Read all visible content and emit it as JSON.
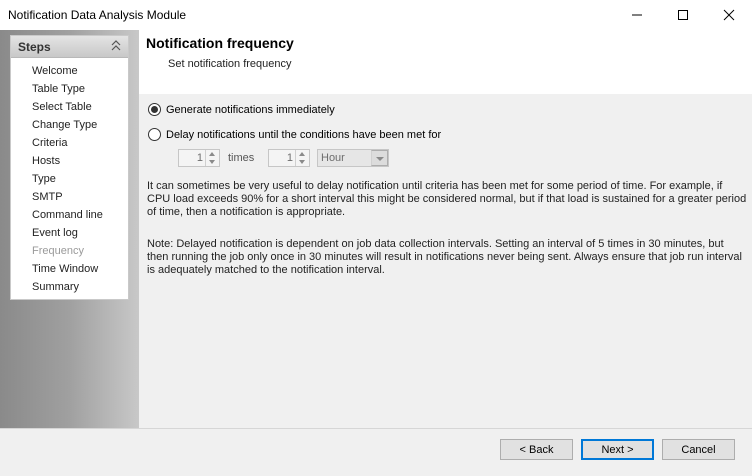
{
  "window": {
    "title": "Notification Data Analysis Module"
  },
  "steps": {
    "header": "Steps",
    "items": [
      "Welcome",
      "Table Type",
      "Select Table",
      "Change Type",
      "Criteria",
      "Hosts",
      "Type",
      "SMTP",
      "Command line",
      "Event log",
      "Frequency",
      "Time Window",
      "Summary"
    ],
    "current": "Frequency"
  },
  "page": {
    "title": "Notification frequency",
    "subtitle": "Set notification frequency"
  },
  "options": {
    "immediate_label": "Generate notifications immediately",
    "immediate_selected": true,
    "delay_label": "Delay notifications until the conditions have been met for",
    "delay_selected": false,
    "times_value": "1",
    "times_label": "times",
    "interval_value": "1",
    "unit_value": "Hour"
  },
  "text": {
    "para1": "It can sometimes be very useful to delay notification until criteria has been met for some period of time.  For example, if CPU load exceeds 90% for a short interval this might be considered normal, but if that load is sustained for a greater period of time, then a notification is appropriate.",
    "para2": "Note: Delayed notification is dependent on job data collection intervals.  Setting an interval of 5 times in 30 minutes, but then running the job only once in 30 minutes will result in notifications never being sent.  Always ensure that job run interval is adequately matched to the notification interval."
  },
  "buttons": {
    "back": "< Back",
    "next": "Next >",
    "cancel": "Cancel"
  }
}
